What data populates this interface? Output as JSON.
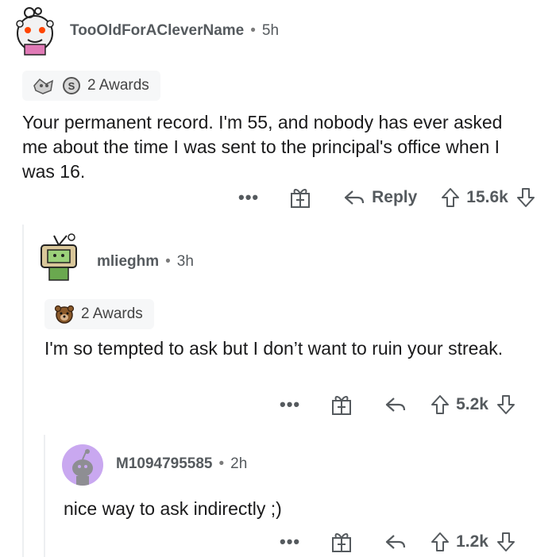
{
  "comments": [
    {
      "author": "TooOldForACleverName",
      "age": "5h",
      "awards_label": "2 Awards",
      "body": "Your permanent record. I'm 55, and nobody has ever asked me about the time I was sent to the principal's office when I was 16.",
      "more": "•••",
      "reply_label": "Reply",
      "score": "15.6k"
    },
    {
      "author": "mlieghm",
      "age": "3h",
      "awards_label": "2 Awards",
      "body": "I'm so tempted to ask but I don’t want to ruin your streak.",
      "more": "•••",
      "score": "5.2k"
    },
    {
      "author": "M1094795585",
      "age": "2h",
      "body": "nice way to ask indirectly ;)",
      "more": "•••",
      "score": "1.2k"
    }
  ],
  "separator": "•",
  "colors": {
    "text": "#1a1a1b",
    "meta": "#555a5e",
    "award_bg": "#f6f7f8",
    "thread_line": "#edeff1",
    "avatar3_bg": "#c9a8f0"
  },
  "icons": [
    "more-icon",
    "gift-icon",
    "reply-icon",
    "upvote-icon",
    "downvote-icon",
    "silver-award-icon",
    "wholesome-award-icon",
    "bear-award-icon"
  ]
}
